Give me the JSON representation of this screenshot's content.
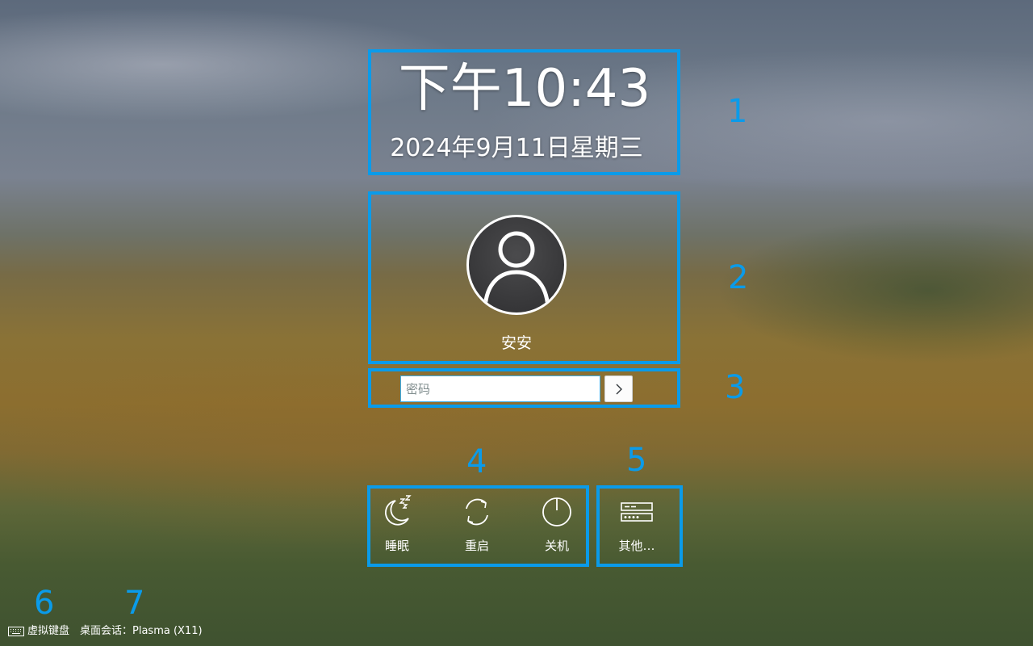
{
  "clock": {
    "time": "下午10:43",
    "date": "2024年9月11日星期三"
  },
  "user": {
    "name": "安安",
    "avatar_icon": "user-avatar-icon"
  },
  "login": {
    "password_placeholder": "密码",
    "password_value": "",
    "submit_icon": "chevron-right-icon"
  },
  "actions": [
    {
      "label": "睡眠",
      "icon": "sleep-moon-icon"
    },
    {
      "label": "重启",
      "icon": "restart-icon"
    },
    {
      "label": "关机",
      "icon": "power-icon"
    }
  ],
  "other": {
    "label": "其他…",
    "icon": "switch-user-icon"
  },
  "footer": {
    "keyboard_label": "虚拟键盘",
    "keyboard_icon": "keyboard-icon",
    "session_label": "桌面会话：Plasma (X11)"
  },
  "annotations": {
    "color": "#0a9bea",
    "numbers": [
      "1",
      "2",
      "3",
      "4",
      "5",
      "6",
      "7"
    ]
  }
}
